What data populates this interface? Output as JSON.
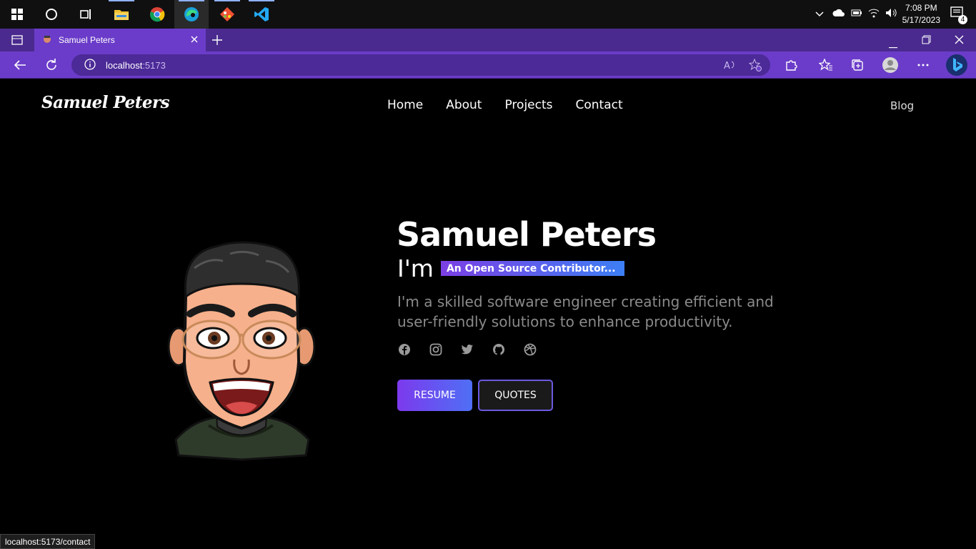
{
  "os": {
    "clock_time": "7:08 PM",
    "clock_date": "5/17/2023",
    "notification_count": "4"
  },
  "browser": {
    "tab_title": "Samuel Peters",
    "url_host": "localhost",
    "url_port": ":5173",
    "status_url": "localhost:5173/contact",
    "accent": "#6b3cc9"
  },
  "site": {
    "logo": "Samuel Peters",
    "nav": [
      "Home",
      "About",
      "Projects",
      "Contact"
    ],
    "blog": "Blog"
  },
  "hero": {
    "name": "Samuel Peters",
    "im": "I'm",
    "typed": "An Open Source Contributor...",
    "description": "I'm a skilled software engineer creating efficient and user-friendly solutions to enhance productivity.",
    "socials": [
      "facebook-icon",
      "instagram-icon",
      "twitter-icon",
      "github-icon",
      "dribbble-icon"
    ],
    "resume_label": "RESUME",
    "quotes_label": "QUOTES"
  }
}
